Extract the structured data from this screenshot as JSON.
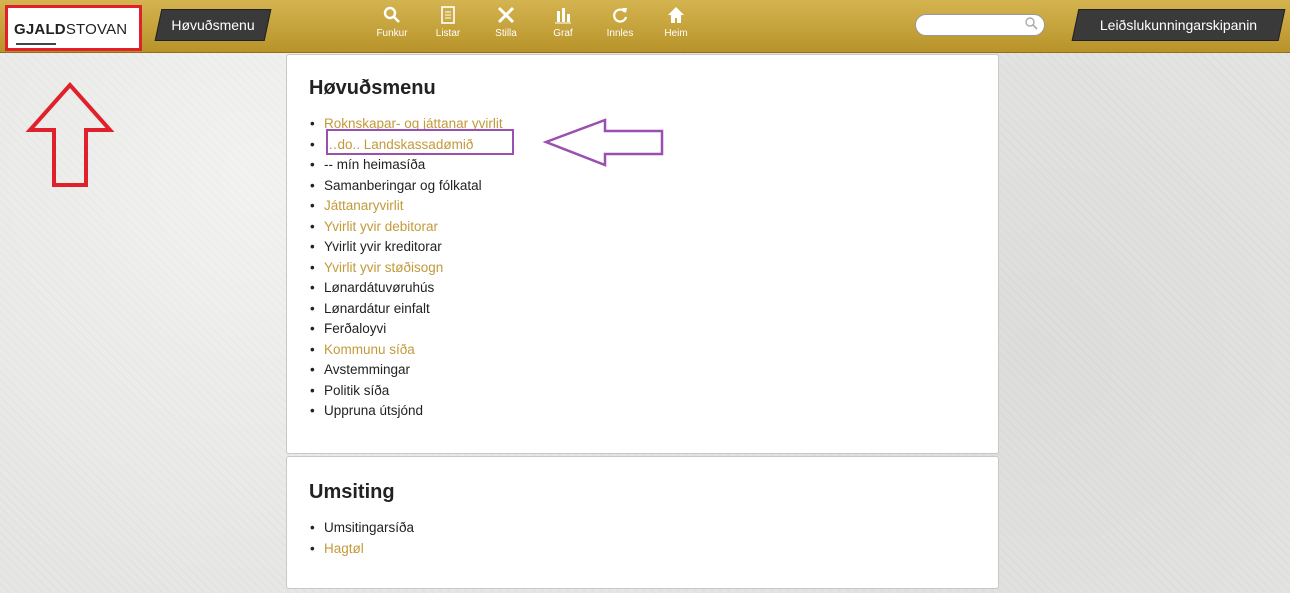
{
  "topbar": {
    "logo_bold": "GJALD",
    "logo_rest": "STOVAN",
    "menu_button": "Høvuðsmenu",
    "nav": [
      {
        "icon": "search-icon",
        "label": "Funkur"
      },
      {
        "icon": "document-icon",
        "label": "Listar"
      },
      {
        "icon": "tools-icon",
        "label": "Stilla"
      },
      {
        "icon": "bar-chart-icon",
        "label": "Graf"
      },
      {
        "icon": "refresh-icon",
        "label": "Innles"
      },
      {
        "icon": "home-icon",
        "label": "Heim"
      }
    ],
    "search_placeholder": "",
    "org_button": "Leiðslukunningarskipanin"
  },
  "main_panel": {
    "title": "Høvuðsmenu",
    "items": [
      {
        "label": "Roknskapar- og játtanar yvirlit",
        "link": true
      },
      {
        "label": "…do.. Landskassadømið",
        "link": true
      },
      {
        "label": "-- mín heimasíða",
        "link": false
      },
      {
        "label": "Samanberingar og fólkatal",
        "link": false
      },
      {
        "label": "Játtanaryvirlit",
        "link": true
      },
      {
        "label": "Yvirlit yvir debitorar",
        "link": true
      },
      {
        "label": "Yvirlit yvir kreditorar",
        "link": false
      },
      {
        "label": "Yvirlit yvir støðisogn",
        "link": true
      },
      {
        "label": "Lønardátuvøruhús",
        "link": false
      },
      {
        "label": "Lønardátur einfalt",
        "link": false
      },
      {
        "label": "Ferðaloyvi",
        "link": false
      },
      {
        "label": "Kommunu síða",
        "link": true
      },
      {
        "label": "Avstemmingar",
        "link": false
      },
      {
        "label": "Politik síða",
        "link": false
      },
      {
        "label": "Uppruna útsjónd",
        "link": false
      }
    ]
  },
  "admin_panel": {
    "title": "Umsiting",
    "items": [
      {
        "label": "Umsitingarsíða",
        "link": false
      },
      {
        "label": "Hagtøl",
        "link": true
      }
    ]
  },
  "colors": {
    "topbar": "#c4a23c",
    "link": "#c39a3a",
    "annotation_red": "#e0202a",
    "annotation_purple": "#9b4fb0"
  }
}
